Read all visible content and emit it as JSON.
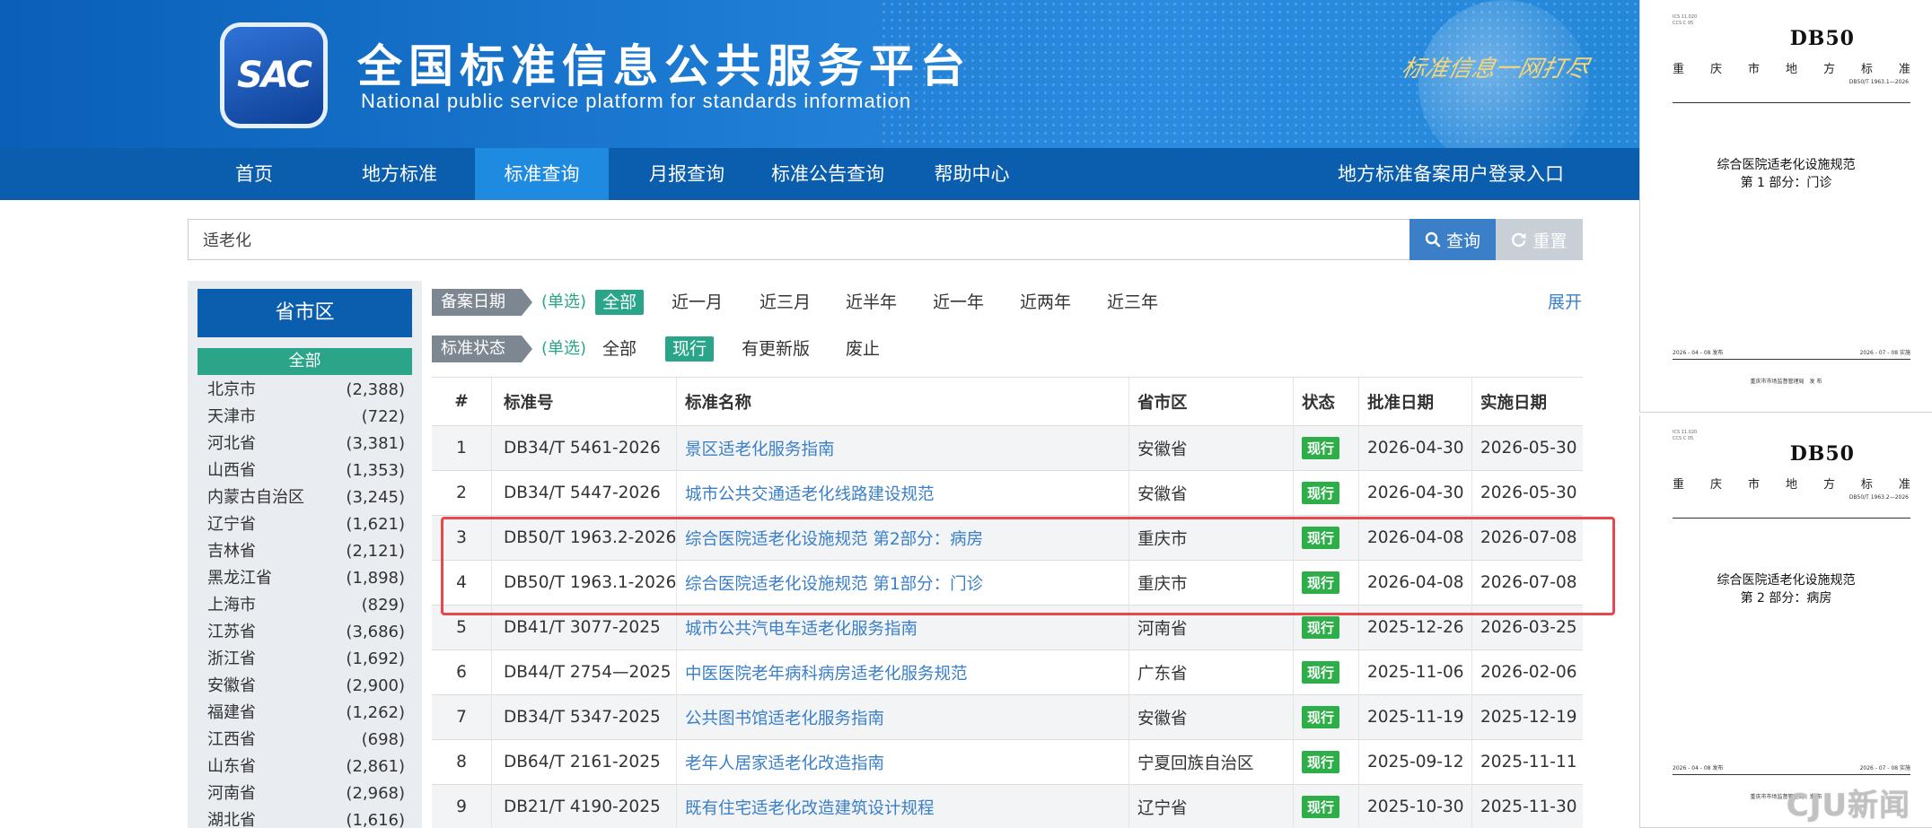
{
  "banner": {
    "logo_text": "SAC",
    "title": "全国标准信息公共服务平台",
    "subtitle": "National public service platform  for standards information",
    "slogan": "标准信息一网打尽"
  },
  "nav": {
    "items": [
      "首页",
      "地方标准",
      "标准查询",
      "月报查询",
      "标准公告查询",
      "帮助中心"
    ],
    "active_index": 2,
    "login": "地方标准备案用户登录入口"
  },
  "search": {
    "value": "适老化",
    "search_label": "查询",
    "reset_label": "重置"
  },
  "sidebar": {
    "header": "省市区",
    "all_label": "全部",
    "provinces": [
      {
        "name": "北京市",
        "count": "(2,388)"
      },
      {
        "name": "天津市",
        "count": "(722)"
      },
      {
        "name": "河北省",
        "count": "(3,381)"
      },
      {
        "name": "山西省",
        "count": "(1,353)"
      },
      {
        "name": "内蒙古自治区",
        "count": "(3,245)"
      },
      {
        "name": "辽宁省",
        "count": "(1,621)"
      },
      {
        "name": "吉林省",
        "count": "(2,121)"
      },
      {
        "name": "黑龙江省",
        "count": "(1,898)"
      },
      {
        "name": "上海市",
        "count": "(829)"
      },
      {
        "name": "江苏省",
        "count": "(3,686)"
      },
      {
        "name": "浙江省",
        "count": "(1,692)"
      },
      {
        "name": "安徽省",
        "count": "(2,900)"
      },
      {
        "name": "福建省",
        "count": "(1,262)"
      },
      {
        "name": "江西省",
        "count": "(698)"
      },
      {
        "name": "山东省",
        "count": "(2,861)"
      },
      {
        "name": "河南省",
        "count": "(2,968)"
      },
      {
        "name": "湖北省",
        "count": "(1,616)"
      }
    ]
  },
  "filters": {
    "date": {
      "label": "备案日期",
      "note": "(单选)",
      "options": [
        "全部",
        "近一月",
        "近三月",
        "近半年",
        "近一年",
        "近两年",
        "近三年"
      ],
      "selected_index": 0
    },
    "status": {
      "label": "标准状态",
      "note": "(单选)",
      "options": [
        "全部",
        "现行",
        "有更新版",
        "废止"
      ],
      "selected_index": 1
    },
    "expand": "展开"
  },
  "table": {
    "headers": [
      "#",
      "标准号",
      "标准名称",
      "省市区",
      "状态",
      "批准日期",
      "实施日期"
    ],
    "rows": [
      {
        "num": "1",
        "code": "DB34/T 5461-2026",
        "name": "景区适老化服务指南",
        "province": "安徽省",
        "status": "现行",
        "approved": "2026-04-30",
        "implemented": "2026-05-30"
      },
      {
        "num": "2",
        "code": "DB34/T 5447-2026",
        "name": "城市公共交通适老化线路建设规范",
        "province": "安徽省",
        "status": "现行",
        "approved": "2026-04-30",
        "implemented": "2026-05-30"
      },
      {
        "num": "3",
        "code": "DB50/T 1963.2-2026",
        "name": "综合医院适老化设施规范 第2部分：病房",
        "province": "重庆市",
        "status": "现行",
        "approved": "2026-04-08",
        "implemented": "2026-07-08"
      },
      {
        "num": "4",
        "code": "DB50/T 1963.1-2026",
        "name": "综合医院适老化设施规范 第1部分：门诊",
        "province": "重庆市",
        "status": "现行",
        "approved": "2026-04-08",
        "implemented": "2026-07-08"
      },
      {
        "num": "5",
        "code": "DB41/T 3077-2025",
        "name": "城市公共汽电车适老化服务指南",
        "province": "河南省",
        "status": "现行",
        "approved": "2025-12-26",
        "implemented": "2026-03-25"
      },
      {
        "num": "6",
        "code": "DB44/T 2754—2025",
        "name": "中医医院老年病科病房适老化服务规范",
        "province": "广东省",
        "status": "现行",
        "approved": "2025-11-06",
        "implemented": "2026-02-06"
      },
      {
        "num": "7",
        "code": "DB34/T 5347-2025",
        "name": "公共图书馆适老化服务指南",
        "province": "安徽省",
        "status": "现行",
        "approved": "2025-11-19",
        "implemented": "2025-12-19"
      },
      {
        "num": "8",
        "code": "DB64/T 2161-2025",
        "name": "老年人居家适老化改造指南",
        "province": "宁夏回族自治区",
        "status": "现行",
        "approved": "2025-09-12",
        "implemented": "2025-11-11"
      },
      {
        "num": "9",
        "code": "DB21/T 4190-2025",
        "name": "既有住宅适老化改造建筑设计规程",
        "province": "辽宁省",
        "status": "现行",
        "approved": "2025-10-30",
        "implemented": "2025-11-30"
      }
    ]
  },
  "preview": {
    "docs": [
      {
        "ics": "ICS 11.020",
        "ccs": "CCS C 05",
        "db": "DB50",
        "region": [
          "重",
          "庆",
          "市",
          "地",
          "方",
          "标",
          "准"
        ],
        "code": "DB50/T 1963.1—2026",
        "title": "综合医院适老化设施规范",
        "part": "第 1 部分：门诊",
        "issued": "2026 - 04 - 08 发布",
        "effective": "2026 - 07 - 08 实施",
        "issuer": "重庆市市场监督管理局　发 布"
      },
      {
        "ics": "ICS 11.020",
        "ccs": "CCS C 05",
        "db": "DB50",
        "region": [
          "重",
          "庆",
          "市",
          "地",
          "方",
          "标",
          "准"
        ],
        "code": "DB50/T 1963.2—2026",
        "title": "综合医院适老化设施规范",
        "part": "第 2 部分：病房",
        "issued": "2026 - 04 - 08 发布",
        "effective": "2026 - 07 - 08 实施",
        "issuer": "重庆市市场监督管理局　发 布"
      }
    ],
    "watermark": "CJU新闻"
  },
  "colors": {
    "brand_blue": "#0b5ead",
    "nav_active": "#1e8be0",
    "green": "#2aa58a",
    "status_green": "#2eae48",
    "link_blue": "#3a7fc8",
    "highlight_red": "#e8474c"
  }
}
